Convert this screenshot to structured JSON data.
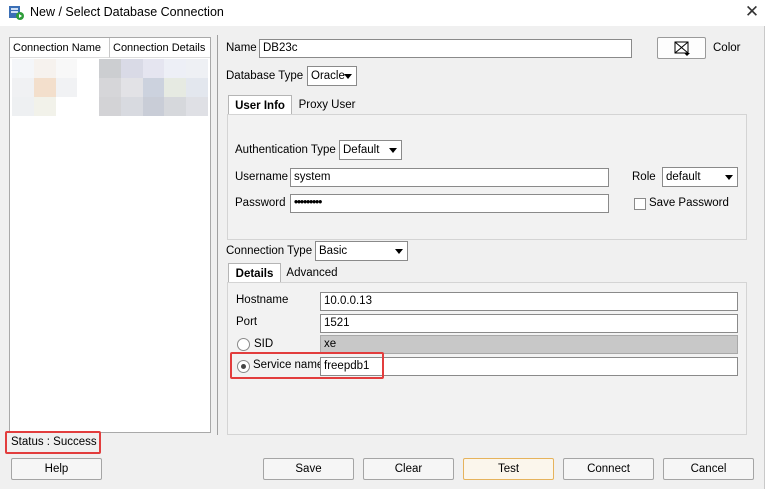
{
  "window": {
    "title": "New / Select Database Connection",
    "close_label": "✕"
  },
  "connections_table": {
    "columns": [
      "Connection Name",
      "Connection Details"
    ]
  },
  "form": {
    "name_label": "Name",
    "name_value": "DB23c",
    "color_label": "Color",
    "database_type_label": "Database Type",
    "database_type_value": "Oracle",
    "tabs": [
      "User Info",
      "Proxy User"
    ],
    "active_tab": "User Info",
    "auth_type_label": "Authentication Type",
    "auth_type_value": "Default",
    "username_label": "Username",
    "username_value": "system",
    "password_label": "Password",
    "password_value": "•••••••••",
    "role_label": "Role",
    "role_value": "default",
    "save_password_label": "Save Password",
    "save_password_checked": false,
    "connection_type_label": "Connection Type",
    "connection_type_value": "Basic",
    "sub_tabs": [
      "Details",
      "Advanced"
    ],
    "active_sub_tab": "Details",
    "hostname_label": "Hostname",
    "hostname_value": "10.0.0.13",
    "port_label": "Port",
    "port_value": "1521",
    "sid_label": "SID",
    "sid_value": "xe",
    "service_name_label": "Service name",
    "service_name_value": "freepdb1",
    "service_name_selected": true
  },
  "status": {
    "text": "Status : Success"
  },
  "buttons": {
    "help": "Help",
    "save": "Save",
    "clear": "Clear",
    "test": "Test",
    "connect": "Connect",
    "cancel": "Cancel"
  },
  "colors": {
    "highlight": "#e23d3d",
    "default_button_border": "#e6b35c"
  },
  "icons": [
    "sql-developer-icon",
    "close-icon",
    "color-picker-icon",
    "dropdown-arrow-icon",
    "radio-icon",
    "checkbox-icon"
  ]
}
